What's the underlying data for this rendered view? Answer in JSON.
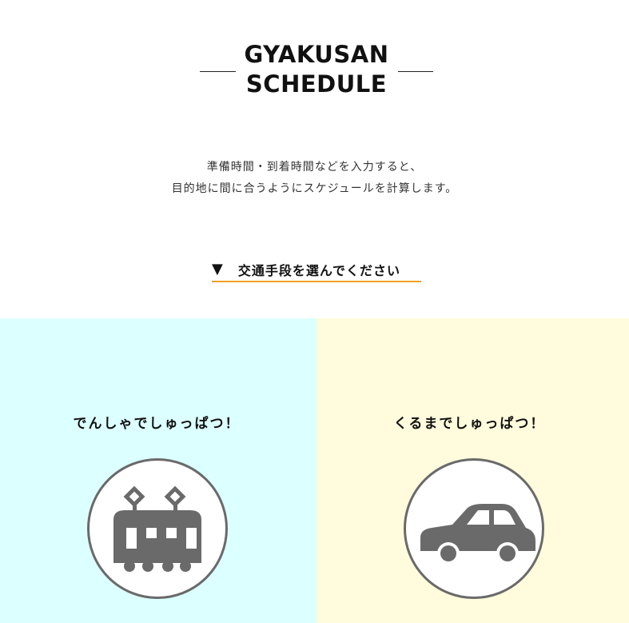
{
  "header": {
    "title_line1": "GYAKUSAN",
    "title_line2": "SCHEDULE"
  },
  "description": {
    "line1": "準備時間・到着時間などを入力すると、",
    "line2": "目的地に間に合うようにスケジュールを計算します。"
  },
  "prompt": {
    "arrow": "▼",
    "label": "交通手段を選んでください"
  },
  "options": {
    "train": {
      "label": "でんしゃでしゅっぱつ！",
      "icon": "train-icon",
      "background": "#dcffff"
    },
    "car": {
      "label": "くるまでしゅっぱつ！",
      "icon": "car-icon",
      "background": "#fffbdc"
    }
  },
  "colors": {
    "accent_underline": "#f0a020",
    "icon_gray": "#6a6a6a"
  }
}
